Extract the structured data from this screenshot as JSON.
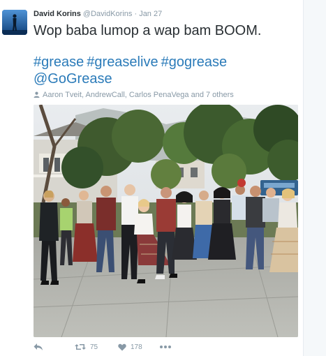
{
  "tweet": {
    "author_name": "David Korins",
    "author_handle": "@DavidKorins",
    "separator": "·",
    "date": "Jan 27",
    "text": "Wop baba lumop a wap bam BOOM.",
    "hashtags": [
      "#grease",
      "#greaselive",
      "#gogrease"
    ],
    "mention": "@GoGrease",
    "tagged_people": "Aaron Tveit, AndrewCall, Carlos PenaVega and 7 others",
    "retweet_count": "75",
    "like_count": "178"
  },
  "icons": {
    "avatar": "silhouette-avatar",
    "tagged": "person-icon",
    "reply": "reply-icon",
    "retweet": "retweet-icon",
    "like": "heart-icon",
    "more": "more-dots-icon"
  },
  "colors": {
    "link": "#2b7bb9",
    "muted": "#8899a6",
    "text": "#292f33"
  }
}
